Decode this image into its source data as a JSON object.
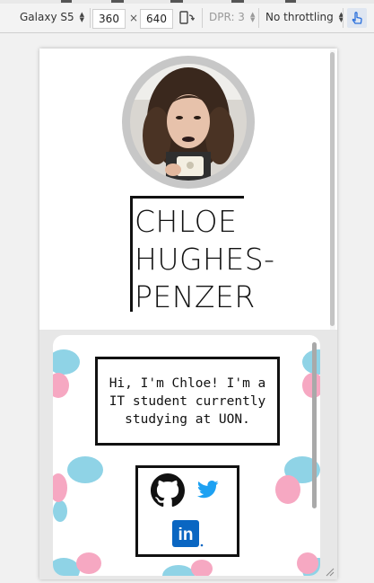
{
  "devtools": {
    "device": "Galaxy S5",
    "width": "360",
    "height": "640",
    "times_symbol": "×",
    "dpr": "DPR: 3",
    "throttling": "No throttling"
  },
  "profile": {
    "name_lines": [
      "CHLOE",
      "HUGHES-",
      "PENZER"
    ],
    "bio": [
      "Hi, I'm Chloe! I'm a",
      "IT student currently",
      "studying at UON."
    ]
  },
  "social": {
    "icons": [
      "github-icon",
      "twitter-icon",
      "linkedin-icon"
    ],
    "linkedin_text": "in",
    "colors": {
      "github": "#111111",
      "twitter": "#1da1f2",
      "linkedin": "#0a66c2"
    }
  },
  "colors": {
    "pattern_blue": "#8fd3e6",
    "pattern_pink": "#f6a8c2",
    "avatar_ring": "#c7c7c7",
    "band": "#e7e7e7"
  }
}
